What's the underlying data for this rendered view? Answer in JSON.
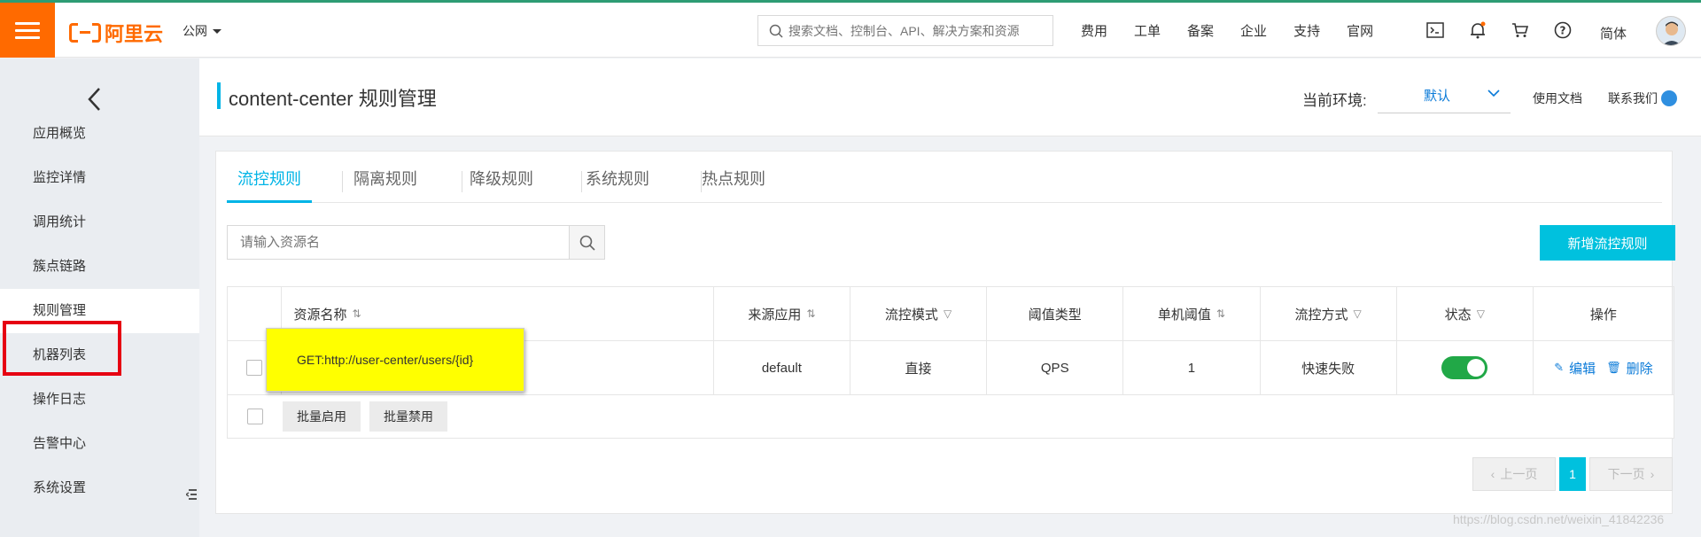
{
  "topbar": {
    "logo_text": "阿里云",
    "region": "公网",
    "search_placeholder": "搜索文档、控制台、API、解决方案和资源",
    "nav": [
      "费用",
      "工单",
      "备案",
      "企业",
      "支持",
      "官网"
    ],
    "icons": [
      "terminal-icon",
      "bell-icon",
      "cart-icon",
      "help-icon"
    ],
    "lang": "简体"
  },
  "sidebar": {
    "items": [
      "应用概览",
      "监控详情",
      "调用统计",
      "簇点链路",
      "规则管理",
      "机器列表",
      "操作日志",
      "告警中心",
      "系统设置"
    ],
    "active": "规则管理"
  },
  "header": {
    "title": "content-center 规则管理",
    "env_label": "当前环境:",
    "env_value": "默认",
    "doc_link": "使用文档",
    "contact_link": "联系我们"
  },
  "tabs": [
    "流控规则",
    "隔离规则",
    "降级规则",
    "系统规则",
    "热点规则"
  ],
  "search": {
    "placeholder": "请输入资源名"
  },
  "add_button": "新增流控规则",
  "table": {
    "headers": [
      "资源名称",
      "来源应用",
      "流控模式",
      "阈值类型",
      "单机阈值",
      "流控方式",
      "状态",
      "操作"
    ],
    "rows": [
      {
        "resource": "GET:http://user-center/users/{id}",
        "origin": "default",
        "mode": "直接",
        "threshold_type": "QPS",
        "threshold": "1",
        "control": "快速失败",
        "enabled": true,
        "edit": "编辑",
        "delete": "删除"
      }
    ],
    "batch_enable": "批量启用",
    "batch_disable": "批量禁用"
  },
  "pager": {
    "prev": "上一页",
    "current": "1",
    "next": "下一页"
  },
  "watermark": "https://blog.csdn.net/weixin_41842236",
  "colors": {
    "brand": "#ff6a00",
    "accent": "#00c1de",
    "link": "#0a7ad8",
    "toggle_on": "#21a847",
    "highlight": "#ffff00"
  }
}
